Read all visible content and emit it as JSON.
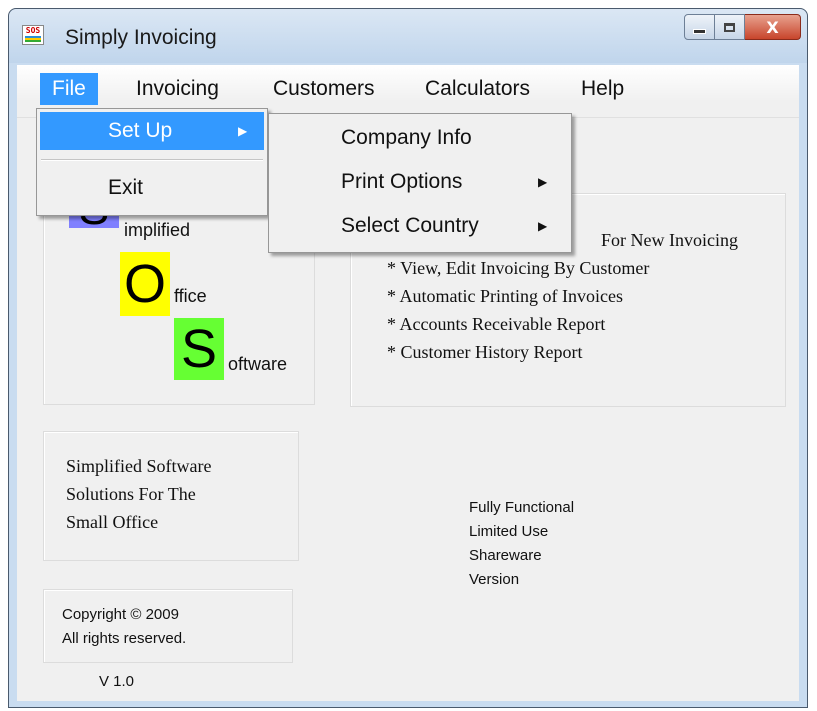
{
  "window": {
    "title": "Simply Invoicing",
    "icon_text": "SOS",
    "close_glyph": "X"
  },
  "menubar": {
    "items": [
      "File",
      "Invoicing",
      "Customers",
      "Calculators",
      "Help"
    ],
    "active": "File"
  },
  "file_menu": {
    "items": [
      "Set Up",
      "Exit"
    ],
    "highlighted": "Set Up",
    "arrow": "▶"
  },
  "setup_submenu": {
    "items": [
      "Company Info",
      "Print Options",
      "Select Country"
    ],
    "arrow": "▶"
  },
  "logo": {
    "s1_letter": "S",
    "s1_word": "implified",
    "o_letter": "O",
    "o_word": "ffice",
    "s2_letter": "S",
    "s2_word": "oftware",
    "colors": {
      "s1": "#8080ff",
      "o": "#ffff00",
      "s2": "#66ff33"
    }
  },
  "features": {
    "line1": "For New Invoicing",
    "line2": "* View, Edit Invoicing By Customer",
    "line3": "* Automatic Printing of Invoices",
    "line4": "* Accounts Receivable Report",
    "line5": "* Customer History Report"
  },
  "tagline": {
    "line1": "Simplified Software",
    "line2": "Solutions For The",
    "line3": "Small Office"
  },
  "version_info": {
    "line1": "Fully Functional",
    "line2": "Limited Use",
    "line3": "Shareware",
    "line4": "Version"
  },
  "copyright": {
    "line1": "Copyright ©  2009",
    "line2": "All rights reserved."
  },
  "version": "V 1.0"
}
